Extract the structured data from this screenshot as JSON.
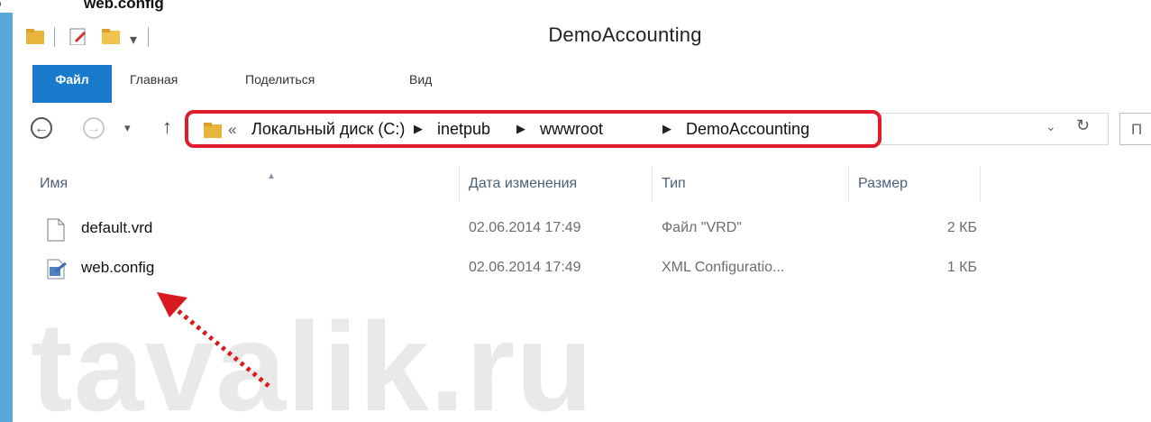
{
  "caption": {
    "bullet": "o",
    "text": "web.config"
  },
  "window": {
    "title": "DemoAccounting"
  },
  "ribbon": {
    "tabs": [
      {
        "label": "Файл"
      },
      {
        "label": "Главная"
      },
      {
        "label": "Поделиться"
      },
      {
        "label": "Вид"
      }
    ]
  },
  "address": {
    "prefix": "«",
    "crumbs": [
      "Локальный диск (C:)",
      "inetpub",
      "wwwroot",
      "DemoAccounting"
    ],
    "search_placeholder": "П"
  },
  "columns": {
    "name": "Имя",
    "date": "Дата изменения",
    "type": "Тип",
    "size": "Размер"
  },
  "files": [
    {
      "name": "default.vrd",
      "date": "02.06.2014 17:49",
      "type": "Файл \"VRD\"",
      "size": "2 КБ",
      "icon": "file-icon"
    },
    {
      "name": "web.config",
      "date": "02.06.2014 17:49",
      "type": "XML Configuratio...",
      "size": "1 КБ",
      "icon": "config-file-icon"
    }
  ],
  "watermark": "tavalik.ru",
  "colors": {
    "accent": "#1979ca",
    "highlight": "#e01b2a",
    "border": "#5aa6d9"
  }
}
